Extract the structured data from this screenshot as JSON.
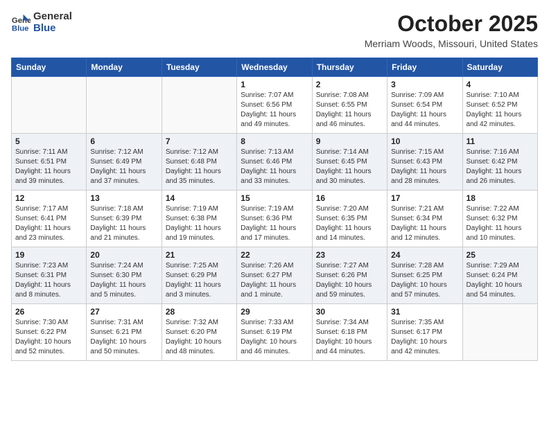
{
  "header": {
    "logo_general": "General",
    "logo_blue": "Blue",
    "title": "October 2025",
    "location": "Merriam Woods, Missouri, United States"
  },
  "weekdays": [
    "Sunday",
    "Monday",
    "Tuesday",
    "Wednesday",
    "Thursday",
    "Friday",
    "Saturday"
  ],
  "weeks": [
    [
      {
        "day": "",
        "info": ""
      },
      {
        "day": "",
        "info": ""
      },
      {
        "day": "",
        "info": ""
      },
      {
        "day": "1",
        "info": "Sunrise: 7:07 AM\nSunset: 6:56 PM\nDaylight: 11 hours\nand 49 minutes."
      },
      {
        "day": "2",
        "info": "Sunrise: 7:08 AM\nSunset: 6:55 PM\nDaylight: 11 hours\nand 46 minutes."
      },
      {
        "day": "3",
        "info": "Sunrise: 7:09 AM\nSunset: 6:54 PM\nDaylight: 11 hours\nand 44 minutes."
      },
      {
        "day": "4",
        "info": "Sunrise: 7:10 AM\nSunset: 6:52 PM\nDaylight: 11 hours\nand 42 minutes."
      }
    ],
    [
      {
        "day": "5",
        "info": "Sunrise: 7:11 AM\nSunset: 6:51 PM\nDaylight: 11 hours\nand 39 minutes."
      },
      {
        "day": "6",
        "info": "Sunrise: 7:12 AM\nSunset: 6:49 PM\nDaylight: 11 hours\nand 37 minutes."
      },
      {
        "day": "7",
        "info": "Sunrise: 7:12 AM\nSunset: 6:48 PM\nDaylight: 11 hours\nand 35 minutes."
      },
      {
        "day": "8",
        "info": "Sunrise: 7:13 AM\nSunset: 6:46 PM\nDaylight: 11 hours\nand 33 minutes."
      },
      {
        "day": "9",
        "info": "Sunrise: 7:14 AM\nSunset: 6:45 PM\nDaylight: 11 hours\nand 30 minutes."
      },
      {
        "day": "10",
        "info": "Sunrise: 7:15 AM\nSunset: 6:43 PM\nDaylight: 11 hours\nand 28 minutes."
      },
      {
        "day": "11",
        "info": "Sunrise: 7:16 AM\nSunset: 6:42 PM\nDaylight: 11 hours\nand 26 minutes."
      }
    ],
    [
      {
        "day": "12",
        "info": "Sunrise: 7:17 AM\nSunset: 6:41 PM\nDaylight: 11 hours\nand 23 minutes."
      },
      {
        "day": "13",
        "info": "Sunrise: 7:18 AM\nSunset: 6:39 PM\nDaylight: 11 hours\nand 21 minutes."
      },
      {
        "day": "14",
        "info": "Sunrise: 7:19 AM\nSunset: 6:38 PM\nDaylight: 11 hours\nand 19 minutes."
      },
      {
        "day": "15",
        "info": "Sunrise: 7:19 AM\nSunset: 6:36 PM\nDaylight: 11 hours\nand 17 minutes."
      },
      {
        "day": "16",
        "info": "Sunrise: 7:20 AM\nSunset: 6:35 PM\nDaylight: 11 hours\nand 14 minutes."
      },
      {
        "day": "17",
        "info": "Sunrise: 7:21 AM\nSunset: 6:34 PM\nDaylight: 11 hours\nand 12 minutes."
      },
      {
        "day": "18",
        "info": "Sunrise: 7:22 AM\nSunset: 6:32 PM\nDaylight: 11 hours\nand 10 minutes."
      }
    ],
    [
      {
        "day": "19",
        "info": "Sunrise: 7:23 AM\nSunset: 6:31 PM\nDaylight: 11 hours\nand 8 minutes."
      },
      {
        "day": "20",
        "info": "Sunrise: 7:24 AM\nSunset: 6:30 PM\nDaylight: 11 hours\nand 5 minutes."
      },
      {
        "day": "21",
        "info": "Sunrise: 7:25 AM\nSunset: 6:29 PM\nDaylight: 11 hours\nand 3 minutes."
      },
      {
        "day": "22",
        "info": "Sunrise: 7:26 AM\nSunset: 6:27 PM\nDaylight: 11 hours\nand 1 minute."
      },
      {
        "day": "23",
        "info": "Sunrise: 7:27 AM\nSunset: 6:26 PM\nDaylight: 10 hours\nand 59 minutes."
      },
      {
        "day": "24",
        "info": "Sunrise: 7:28 AM\nSunset: 6:25 PM\nDaylight: 10 hours\nand 57 minutes."
      },
      {
        "day": "25",
        "info": "Sunrise: 7:29 AM\nSunset: 6:24 PM\nDaylight: 10 hours\nand 54 minutes."
      }
    ],
    [
      {
        "day": "26",
        "info": "Sunrise: 7:30 AM\nSunset: 6:22 PM\nDaylight: 10 hours\nand 52 minutes."
      },
      {
        "day": "27",
        "info": "Sunrise: 7:31 AM\nSunset: 6:21 PM\nDaylight: 10 hours\nand 50 minutes."
      },
      {
        "day": "28",
        "info": "Sunrise: 7:32 AM\nSunset: 6:20 PM\nDaylight: 10 hours\nand 48 minutes."
      },
      {
        "day": "29",
        "info": "Sunrise: 7:33 AM\nSunset: 6:19 PM\nDaylight: 10 hours\nand 46 minutes."
      },
      {
        "day": "30",
        "info": "Sunrise: 7:34 AM\nSunset: 6:18 PM\nDaylight: 10 hours\nand 44 minutes."
      },
      {
        "day": "31",
        "info": "Sunrise: 7:35 AM\nSunset: 6:17 PM\nDaylight: 10 hours\nand 42 minutes."
      },
      {
        "day": "",
        "info": ""
      }
    ]
  ]
}
